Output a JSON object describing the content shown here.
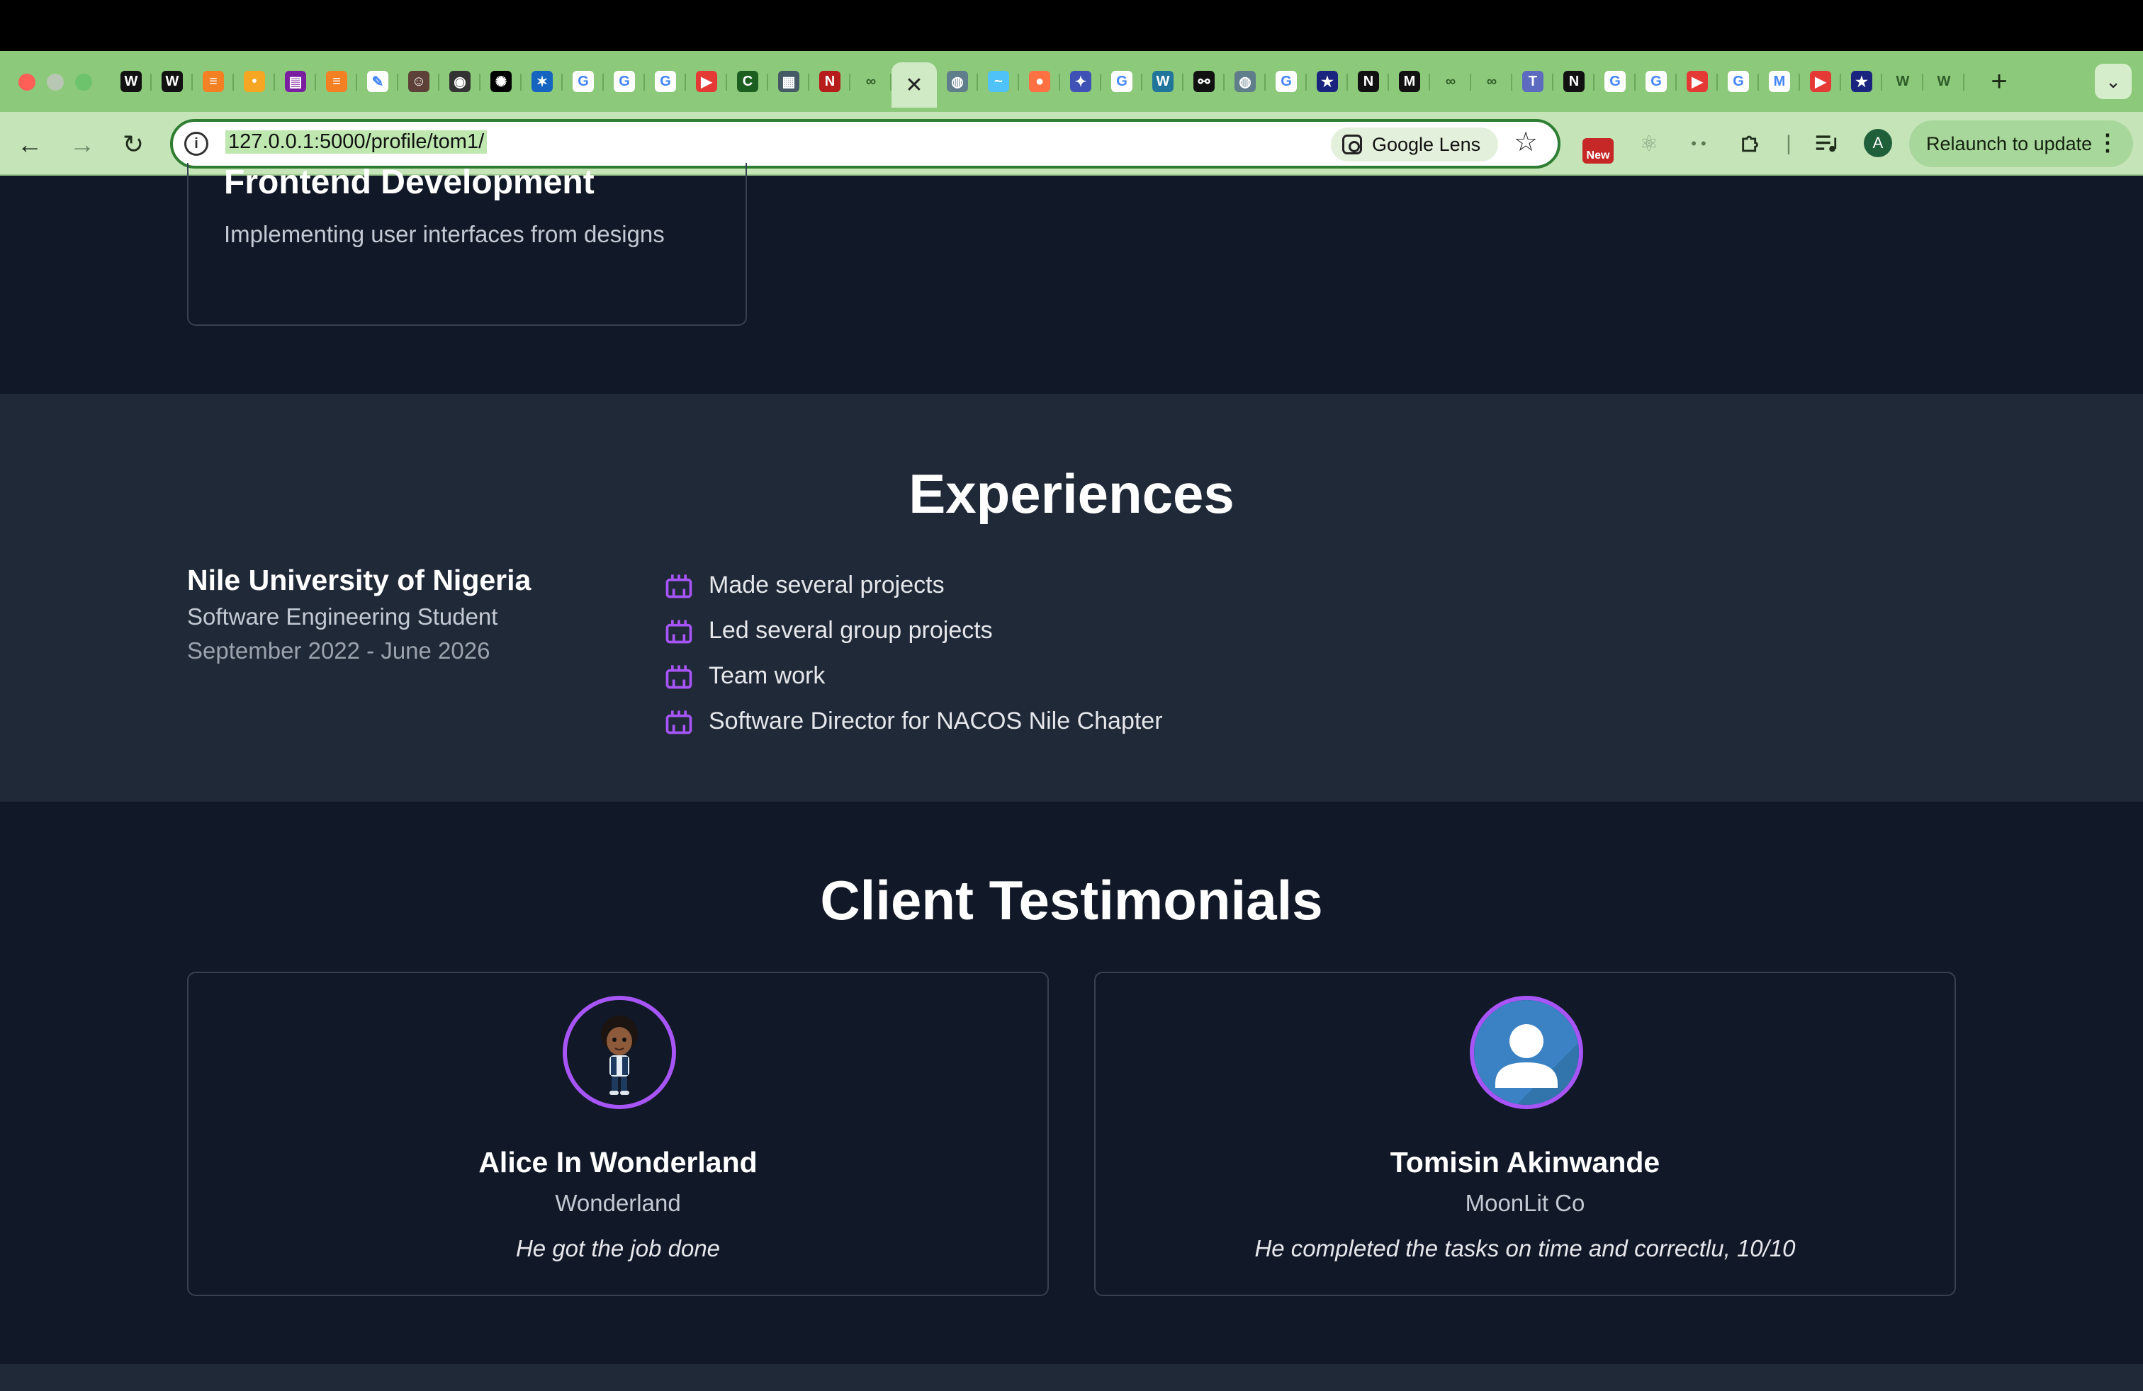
{
  "browser": {
    "tab_favicons": [
      {
        "icon": "w-site-icon",
        "bg": "#111111",
        "glyph": "W"
      },
      {
        "icon": "w-site-icon",
        "bg": "#111111",
        "glyph": "W"
      },
      {
        "icon": "stack-icon",
        "bg": "#f48024",
        "glyph": "≡"
      },
      {
        "icon": "bulb-icon",
        "bg": "#f5a623",
        "glyph": "•"
      },
      {
        "icon": "book-icon",
        "bg": "#7b1fa2",
        "glyph": "▤"
      },
      {
        "icon": "stack-icon",
        "bg": "#f48024",
        "glyph": "≡"
      },
      {
        "icon": "pencil-icon",
        "bg": "#ffffff",
        "glyph": "✎"
      },
      {
        "icon": "robot-icon",
        "bg": "#5d4037",
        "glyph": "☺"
      },
      {
        "icon": "owl-icon",
        "bg": "#333333",
        "glyph": "◉"
      },
      {
        "icon": "openai-icon",
        "bg": "#000000",
        "glyph": "✺"
      },
      {
        "icon": "sparkle-icon",
        "bg": "#1565c0",
        "glyph": "✶"
      },
      {
        "icon": "google-icon",
        "bg": "#ffffff",
        "glyph": "G"
      },
      {
        "icon": "google-icon",
        "bg": "#ffffff",
        "glyph": "G"
      },
      {
        "icon": "google-icon",
        "bg": "#ffffff",
        "glyph": "G"
      },
      {
        "icon": "youtube-icon",
        "bg": "#e53935",
        "glyph": "▶"
      },
      {
        "icon": "c-site-icon",
        "bg": "#1b5e20",
        "glyph": "C"
      },
      {
        "icon": "grid-icon",
        "bg": "#455a64",
        "glyph": "▦"
      },
      {
        "icon": "netflix-icon",
        "bg": "#b71c1c",
        "glyph": "N"
      },
      {
        "icon": "glasses-icon",
        "bg": "#8cc97a",
        "glyph": "∞"
      }
    ],
    "active_tab_close": "✕",
    "tab_favicons_after": [
      {
        "icon": "globe-icon",
        "bg": "#607d8b",
        "glyph": "◍"
      },
      {
        "icon": "tailwind-icon",
        "bg": "#4fc3f7",
        "glyph": "~"
      },
      {
        "icon": "orange-circle-icon",
        "bg": "#ff7043",
        "glyph": "●"
      },
      {
        "icon": "gemini-icon",
        "bg": "#3f51b5",
        "glyph": "✦"
      },
      {
        "icon": "google-icon",
        "bg": "#ffffff",
        "glyph": "G"
      },
      {
        "icon": "wordpress-icon",
        "bg": "#21759b",
        "glyph": "W"
      },
      {
        "icon": "link-icon",
        "bg": "#111111",
        "glyph": "⚯"
      },
      {
        "icon": "globe-icon",
        "bg": "#607d8b",
        "glyph": "◍"
      },
      {
        "icon": "google-icon",
        "bg": "#ffffff",
        "glyph": "G"
      },
      {
        "icon": "star-badge-icon",
        "bg": "#1a237e",
        "glyph": "★"
      },
      {
        "icon": "notion-icon",
        "bg": "#111111",
        "glyph": "N"
      },
      {
        "icon": "medium-icon",
        "bg": "#111111",
        "glyph": "M"
      },
      {
        "icon": "glasses-icon",
        "bg": "#8cc97a",
        "glyph": "∞"
      },
      {
        "icon": "glasses-icon",
        "bg": "#8cc97a",
        "glyph": "∞"
      },
      {
        "icon": "teams-icon",
        "bg": "#5c6bc0",
        "glyph": "T"
      },
      {
        "icon": "notion-icon",
        "bg": "#111111",
        "glyph": "N"
      },
      {
        "icon": "google-icon",
        "bg": "#ffffff",
        "glyph": "G"
      },
      {
        "icon": "google-icon",
        "bg": "#ffffff",
        "glyph": "G"
      },
      {
        "icon": "youtube-icon",
        "bg": "#e53935",
        "glyph": "▶"
      },
      {
        "icon": "google-icon",
        "bg": "#ffffff",
        "glyph": "G"
      },
      {
        "icon": "gmail-icon",
        "bg": "#ffffff",
        "glyph": "M"
      },
      {
        "icon": "youtube-music-icon",
        "bg": "#e53935",
        "glyph": "▶"
      },
      {
        "icon": "star-badge-icon",
        "bg": "#1a237e",
        "glyph": "★"
      },
      {
        "icon": "w-green-icon",
        "bg": "#8cc97a",
        "glyph": "W"
      },
      {
        "icon": "w-green-icon",
        "bg": "#8cc97a",
        "glyph": "W"
      }
    ],
    "url": "127.0.0.1:5000/profile/tom1/",
    "google_lens_label": "Google Lens",
    "new_badge": "New",
    "profile_initial": "A",
    "relaunch_label": "Relaunch to update"
  },
  "services": {
    "card": {
      "title": "Frontend Development",
      "description": "Implementing user interfaces from designs"
    }
  },
  "experiences": {
    "heading": "Experiences",
    "items": [
      {
        "organization": "Nile University of Nigeria",
        "role": "Software Engineering Student",
        "dates": "September 2022 - June 2026",
        "points": [
          "Made several projects",
          "Led several group projects",
          "Team work",
          "Software Director for NACOS Nile Chapter"
        ]
      }
    ]
  },
  "testimonials": {
    "heading": "Client Testimonials",
    "items": [
      {
        "name": "Alice In Wonderland",
        "company": "Wonderland",
        "quote": "He got the job done",
        "avatar": "cartoon-boy-avatar"
      },
      {
        "name": "Tomisin Akinwande",
        "company": "MoonLit Co",
        "quote": "He completed the tasks on time and correctlu, 10/10",
        "avatar": "default-user-avatar"
      }
    ]
  },
  "colors": {
    "page_bg": "#111827",
    "section_alt_bg": "#1f2937",
    "accent": "#a855f7"
  }
}
